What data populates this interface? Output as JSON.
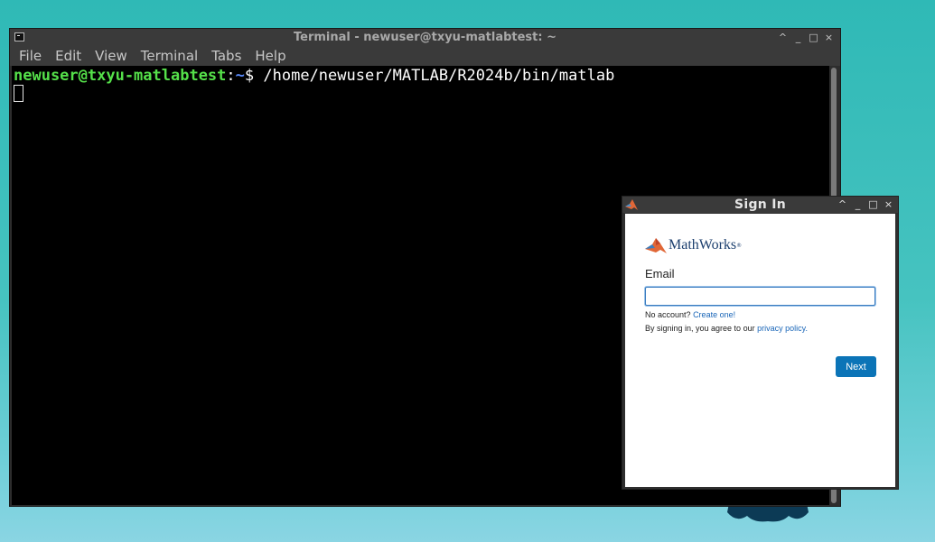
{
  "terminal": {
    "title": "Terminal - newuser@txyu-matlabtest: ~",
    "menu": [
      "File",
      "Edit",
      "View",
      "Terminal",
      "Tabs",
      "Help"
    ],
    "prompt_user_host": "newuser@txyu-matlabtest",
    "prompt_colon": ":",
    "prompt_path": "~",
    "prompt_symbol": "$ ",
    "command": "/home/newuser/MATLAB/R2024b/bin/matlab",
    "window_buttons": {
      "maximize_up": "^",
      "minimize": "_",
      "restore": "□",
      "close": "×"
    }
  },
  "signin": {
    "title": "Sign In",
    "brand": "MathWorks",
    "brand_mark": "®",
    "email_label": "Email",
    "email_value": "",
    "no_account_text": "No account?",
    "create_link": "Create one!",
    "agree_text": "By signing in, you agree to our",
    "privacy_link": "privacy policy.",
    "next_label": "Next",
    "window_buttons": {
      "maximize_up": "^",
      "minimize": "_",
      "restore": "□",
      "close": "×"
    }
  },
  "colors": {
    "desktop": "#2fb9b6",
    "prompt_user": "#55e04a",
    "prompt_path": "#5a8cff",
    "next_button": "#0b74b7",
    "link": "#1a66b8"
  }
}
